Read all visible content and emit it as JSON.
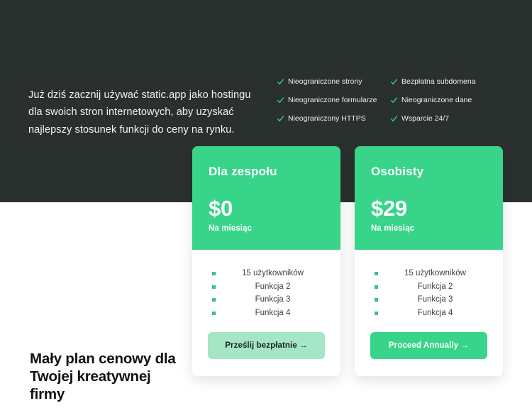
{
  "theme": {
    "dark_bg": "#2a302e",
    "page_bg": "#ffffff",
    "accent_green": "#38d48a",
    "soft_green": "#a4e6c6",
    "bullet_green": "#3fbf83",
    "heading_dark": "#121212"
  },
  "hero": {
    "paragraph": "Już dziś zacznij używać static.app jako hostingu dla swoich stron internetowych, aby uzyskać najlepszy stosunek funkcji do ceny na rynku.",
    "feature_columns": [
      {
        "items": [
          {
            "icon": "check-icon",
            "label": "Nieograniczone strony"
          },
          {
            "icon": "check-icon",
            "label": "Nieograniczone formularze"
          },
          {
            "icon": "check-icon",
            "label": "Nieograniczony HTTPS"
          }
        ]
      },
      {
        "items": [
          {
            "icon": "check-icon",
            "label": "Bezpłatna subdomena"
          },
          {
            "icon": "check-icon",
            "label": "Nieograniczone dane"
          },
          {
            "icon": "check-icon",
            "label": "Wsparcie 24/7"
          }
        ]
      }
    ]
  },
  "pricing": {
    "cards": [
      {
        "name": "Dla zespołu",
        "price": "$0",
        "period": "Na miesiąc",
        "features": [
          "15 użytkowników",
          "Funkcja 2",
          "Funkcja 3",
          "Funkcja 4"
        ],
        "cta_label": "Prześlij bezpłatnie →",
        "cta_style": "soft"
      },
      {
        "name": "Osobisty",
        "price": "$29",
        "period": "Na miesiąc",
        "features": [
          "15 użytkowników",
          "Funkcja 2",
          "Funkcja 3",
          "Funkcja 4"
        ],
        "cta_label": "Proceed Annually →",
        "cta_style": "solid"
      }
    ]
  },
  "bottom": {
    "heading": "Mały plan cenowy dla Twojej kreatywnej firmy"
  }
}
